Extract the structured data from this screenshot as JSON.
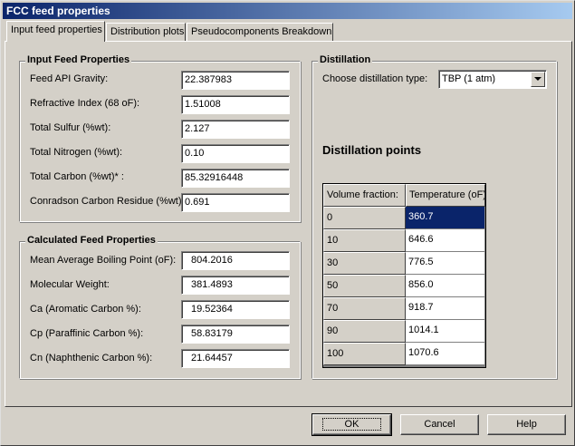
{
  "window": {
    "title": "FCC feed properties"
  },
  "tabs": [
    "Input feed properties",
    "Distribution plots",
    "Pseudocomponents Breakdown"
  ],
  "input_feed": {
    "title": "Input Feed Properties",
    "rows": [
      {
        "label": "Feed API Gravity:",
        "value": "22.387983"
      },
      {
        "label": "Refractive Index (68 oF):",
        "value": "1.51008"
      },
      {
        "label": "Total Sulfur (%wt):",
        "value": "2.127"
      },
      {
        "label": "Total Nitrogen (%wt):",
        "value": "0.10"
      },
      {
        "label": "Total Carbon (%wt)* :",
        "value": "85.32916448"
      },
      {
        "label": "Conradson Carbon Residue (%wt):",
        "value": "0.691"
      }
    ]
  },
  "calculated_feed": {
    "title": "Calculated Feed Properties",
    "rows": [
      {
        "label": "Mean Average Boiling Point (oF):",
        "value": "804.2016"
      },
      {
        "label": "Molecular Weight:",
        "value": "381.4893"
      },
      {
        "label": "Ca (Aromatic Carbon %):",
        "value": "19.52364"
      },
      {
        "label": "Cp (Paraffinic Carbon %):",
        "value": "58.83179"
      },
      {
        "label": "Cn (Naphthenic Carbon %):",
        "value": "21.64457"
      }
    ]
  },
  "distillation": {
    "title": "Distillation",
    "type_label": "Choose distillation type:",
    "type_value": "TBP (1 atm)",
    "points_title": "Distillation points",
    "columns": [
      "Volume fraction:",
      "Temperature (oF):"
    ],
    "rows": [
      {
        "fraction": "0",
        "temp": "360.7"
      },
      {
        "fraction": "10",
        "temp": "646.6"
      },
      {
        "fraction": "30",
        "temp": "776.5"
      },
      {
        "fraction": "50",
        "temp": "856.0"
      },
      {
        "fraction": "70",
        "temp": "918.7"
      },
      {
        "fraction": "90",
        "temp": "1014.1"
      },
      {
        "fraction": "100",
        "temp": "1070.6"
      }
    ]
  },
  "buttons": {
    "ok": "OK",
    "cancel": "Cancel",
    "help": "Help"
  }
}
